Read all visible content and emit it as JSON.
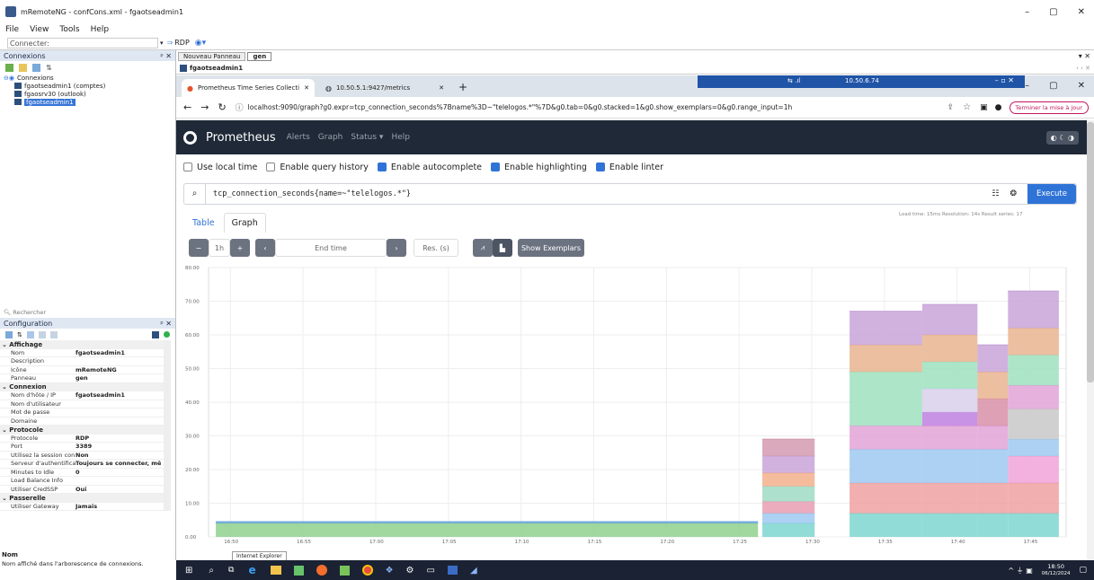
{
  "window": {
    "title": "mRemoteNG - confCons.xml - fgaotseadmin1",
    "min": "–",
    "max": "▢",
    "close": "✕"
  },
  "menu": [
    "File",
    "View",
    "Tools",
    "Help"
  ],
  "toolbar": {
    "connect_label": "Connecter:",
    "rdp_label": "RDP"
  },
  "connections_panel": {
    "title": "Connexions",
    "pin": "ᵖ ✕",
    "items": [
      {
        "label": "Connexions",
        "level": 0
      },
      {
        "label": "fgaotseadmin1 (comptes)",
        "level": 1
      },
      {
        "label": "fgaosrv30 (outlook)",
        "level": 1
      },
      {
        "label": "fgaotseadmin1",
        "level": 1,
        "selected": true
      }
    ],
    "search_placeholder": "Rechercher"
  },
  "config_panel": {
    "title": "Configuration",
    "rows": [
      {
        "type": "cat",
        "label": "Affichage"
      },
      {
        "k": "Nom",
        "v": "fgaotseadmin1"
      },
      {
        "k": "Description",
        "v": ""
      },
      {
        "k": "Icône",
        "v": "mRemoteNG"
      },
      {
        "k": "Panneau",
        "v": "gen"
      },
      {
        "type": "cat",
        "label": "Connexion"
      },
      {
        "k": "Nom d'hôte / IP",
        "v": "fgaotseadmin1"
      },
      {
        "k": "Nom d'utilisateur",
        "v": ""
      },
      {
        "k": "Mot de passe",
        "v": ""
      },
      {
        "k": "Domaine",
        "v": ""
      },
      {
        "type": "cat",
        "label": "Protocole"
      },
      {
        "k": "Protocole",
        "v": "RDP"
      },
      {
        "k": "Port",
        "v": "3389"
      },
      {
        "k": "Utilisez la session con",
        "v": "Non"
      },
      {
        "k": "Serveur d'authentificat",
        "v": "Toujours se connecter, mê"
      },
      {
        "k": "Minutes to Idle",
        "v": "0"
      },
      {
        "k": "Load Balance Info",
        "v": ""
      },
      {
        "k": "Utiliser CredSSP",
        "v": "Oui"
      },
      {
        "type": "cat",
        "label": "Passerelle"
      },
      {
        "k": "Utiliser Gateway",
        "v": "Jamais"
      }
    ],
    "footer_title": "Nom",
    "footer_desc": "Nom affiché dans l'arborescence de connexions."
  },
  "doc_tabs": [
    "Nouveau Panneau",
    "gen"
  ],
  "session_tab": "fgaotseadmin1",
  "browser": {
    "tabs": [
      {
        "label": "Prometheus Time Series Collecti",
        "active": true
      },
      {
        "label": "10.50.5.1:9427/metrics",
        "active": false
      }
    ],
    "new_tab": "+",
    "rdp_bar_ip": "10.50.6.74",
    "url": "localhost:9090/graph?g0.expr=tcp_connection_seconds%7Bname%3D~\"telelogos.*\"%7D&g0.tab=0&g0.stacked=1&g0.show_exemplars=0&g0.range_input=1h",
    "update_button": "Terminer la mise à jour"
  },
  "prometheus": {
    "brand": "Prometheus",
    "nav": [
      "Alerts",
      "Graph",
      "Status ▾",
      "Help"
    ],
    "options": [
      {
        "label": "Use local time",
        "checked": false
      },
      {
        "label": "Enable query history",
        "checked": false
      },
      {
        "label": "Enable autocomplete",
        "checked": true
      },
      {
        "label": "Enable highlighting",
        "checked": true
      },
      {
        "label": "Enable linter",
        "checked": true
      }
    ],
    "query": "tcp_connection_seconds{name=~\"telelogos.*\"}",
    "execute": "Execute",
    "stats": "Load time: 15ms   Resolution: 14s   Result series: 17",
    "tabs": [
      "Table",
      "Graph"
    ],
    "controls": {
      "minus": "−",
      "range": "1h",
      "plus": "+",
      "prev": "‹",
      "end_time": "End time",
      "next": "›",
      "res": "Res. (s)",
      "show_exemplars": "Show Exemplars"
    }
  },
  "chart_data": {
    "type": "area",
    "stacked": true,
    "ylim": [
      0,
      80
    ],
    "yticks": [
      "0.00",
      "10.00",
      "20.00",
      "30.00",
      "40.00",
      "50.00",
      "60.00",
      "70.00",
      "80.00"
    ],
    "xticks": [
      "16:50",
      "16:55",
      "17:00",
      "17:05",
      "17:10",
      "17:15",
      "17:20",
      "17:25",
      "17:30",
      "17:35",
      "17:40",
      "17:45"
    ],
    "x_minutes": [
      0,
      5,
      10,
      15,
      20,
      25,
      30,
      35,
      40,
      45,
      50,
      55
    ],
    "segments": [
      {
        "from": -1,
        "to": 36.3,
        "layers": [
          {
            "v": 4,
            "c": "#8fd18f"
          },
          {
            "v": 0.5,
            "c": "#6fa8dc"
          }
        ]
      },
      {
        "from": 36.6,
        "to": 40.2,
        "layers": [
          {
            "v": 4,
            "c": "#7fd6d0"
          },
          {
            "v": 3,
            "c": "#9ec9f0"
          },
          {
            "v": 3.5,
            "c": "#e89fb3"
          },
          {
            "v": 4.5,
            "c": "#9fdcc5"
          },
          {
            "v": 4,
            "c": "#f2b08c"
          },
          {
            "v": 5,
            "c": "#c9a4d9"
          },
          {
            "v": 5,
            "c": "#d39ab0"
          }
        ]
      },
      {
        "from": 42.6,
        "to": 47.6,
        "layers": [
          {
            "v": 7,
            "c": "#7fd6d0"
          },
          {
            "v": 9,
            "c": "#f0a1a1"
          },
          {
            "v": 10,
            "c": "#9ec9f0"
          },
          {
            "v": 7,
            "c": "#e2a3d6"
          },
          {
            "v": 16,
            "c": "#9fe0c0"
          },
          {
            "v": 8,
            "c": "#e8b48f"
          },
          {
            "v": 10,
            "c": "#c9a4d9"
          }
        ]
      },
      {
        "from": 47.6,
        "to": 51.4,
        "layers": [
          {
            "v": 7,
            "c": "#7fd6d0"
          },
          {
            "v": 9,
            "c": "#f0a1a1"
          },
          {
            "v": 10,
            "c": "#9ec9f0"
          },
          {
            "v": 7,
            "c": "#e2a3d6"
          },
          {
            "v": 4,
            "c": "#c080e0"
          },
          {
            "v": 7,
            "c": "#d8d0ea"
          },
          {
            "v": 8,
            "c": "#9fe0c0"
          },
          {
            "v": 8,
            "c": "#e8b48f"
          },
          {
            "v": 9,
            "c": "#c9a4d9"
          }
        ]
      },
      {
        "from": 51.4,
        "to": 53.5,
        "layers": [
          {
            "v": 7,
            "c": "#7fd6d0"
          },
          {
            "v": 9,
            "c": "#f0a1a1"
          },
          {
            "v": 10,
            "c": "#9ec9f0"
          },
          {
            "v": 7,
            "c": "#e2a3d6"
          },
          {
            "v": 8,
            "c": "#d88fa8"
          },
          {
            "v": 8,
            "c": "#e8b48f"
          },
          {
            "v": 8,
            "c": "#c9a4d9"
          }
        ]
      },
      {
        "from": 53.5,
        "to": 57,
        "layers": [
          {
            "v": 7,
            "c": "#7fd6d0"
          },
          {
            "v": 9,
            "c": "#f0a1a1"
          },
          {
            "v": 8,
            "c": "#f0a3d8"
          },
          {
            "v": 5,
            "c": "#9ec9f0"
          },
          {
            "v": 9,
            "c": "#c8c8c8"
          },
          {
            "v": 7,
            "c": "#e2a3d6"
          },
          {
            "v": 9,
            "c": "#9fe0c0"
          },
          {
            "v": 8,
            "c": "#e8b48f"
          },
          {
            "v": 11,
            "c": "#c9a4d9"
          }
        ]
      }
    ]
  },
  "tooltip": "Internet Explorer",
  "taskbar": {
    "time": "18:50",
    "date": "06/12/2024"
  }
}
